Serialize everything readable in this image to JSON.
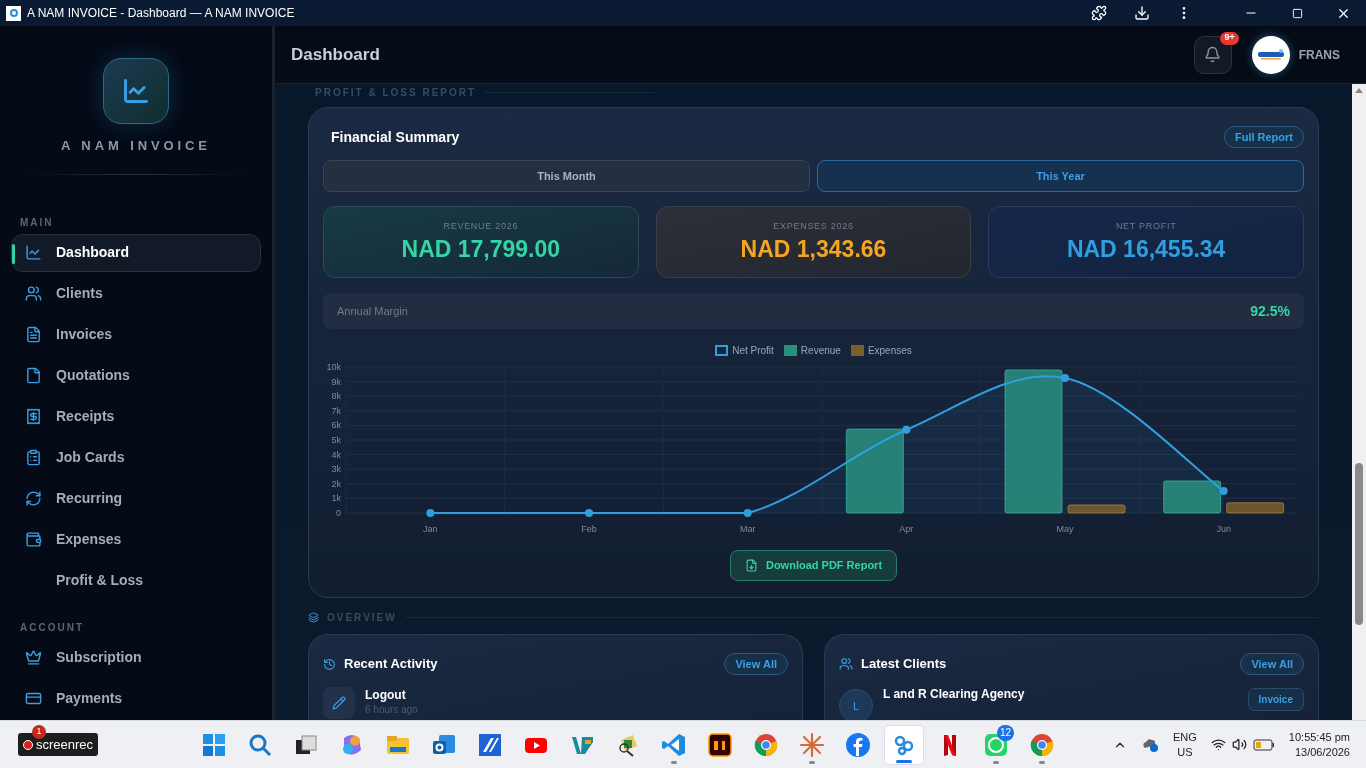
{
  "window": {
    "title": "A NAM INVOICE - Dashboard — A NAM INVOICE"
  },
  "sidebar": {
    "brand": "A NAM INVOICE",
    "sections": [
      {
        "label": "MAIN",
        "items": [
          {
            "label": "Dashboard",
            "selected": true
          },
          {
            "label": "Clients",
            "selected": false
          },
          {
            "label": "Invoices",
            "selected": false
          },
          {
            "label": "Quotations",
            "selected": false
          },
          {
            "label": "Receipts",
            "selected": false
          },
          {
            "label": "Job Cards",
            "selected": false
          },
          {
            "label": "Recurring",
            "selected": false
          },
          {
            "label": "Expenses",
            "selected": false
          },
          {
            "label": "Profit & Loss",
            "selected": false
          }
        ]
      },
      {
        "label": "ACCOUNT",
        "items": [
          {
            "label": "Subscription",
            "selected": false
          },
          {
            "label": "Payments",
            "selected": false
          }
        ]
      }
    ]
  },
  "header": {
    "title": "Dashboard",
    "notification_badge": "9+",
    "user": "FRANS"
  },
  "report": {
    "section_label": "PROFIT & LOSS REPORT",
    "title": "Financial Summary",
    "full_report": "Full Report",
    "tabs": [
      {
        "label": "This Month",
        "selected": false
      },
      {
        "label": "This Year",
        "selected": true
      }
    ],
    "stats": [
      {
        "kind": "revenue",
        "label": "REVENUE 2026",
        "value": "NAD 17,799.00"
      },
      {
        "kind": "expenses",
        "label": "EXPENSES 2026",
        "value": "NAD 1,343.66"
      },
      {
        "kind": "profit",
        "label": "NET PROFIT",
        "value": "NAD 16,455.34"
      }
    ],
    "margin": {
      "label": "Annual Margin",
      "value": "92.5%"
    },
    "chart_data": {
      "type": "bar",
      "stacked": false,
      "grid": true,
      "legend": "top",
      "categories": [
        "Jan",
        "Feb",
        "Mar",
        "Apr",
        "May",
        "Jun"
      ],
      "ylim": [
        0,
        10000
      ],
      "yticks": [
        {
          "value": 0,
          "label": "0"
        },
        {
          "value": 1000,
          "label": "1k"
        },
        {
          "value": 2000,
          "label": "2k"
        },
        {
          "value": 3000,
          "label": "3k"
        },
        {
          "value": 4000,
          "label": "4k"
        },
        {
          "value": 5000,
          "label": "5k"
        },
        {
          "value": 6000,
          "label": "6k"
        },
        {
          "value": 7000,
          "label": "7k"
        },
        {
          "value": 8000,
          "label": "8k"
        },
        {
          "value": 9000,
          "label": "9k"
        },
        {
          "value": 10000,
          "label": "10k"
        }
      ],
      "series": [
        {
          "name": "Net Profit",
          "type": "line",
          "marker": "circle",
          "color": "#2f9fe0",
          "values": [
            0,
            0,
            0,
            5700,
            9250,
            1500
          ]
        },
        {
          "name": "Revenue",
          "type": "bar",
          "color": "#2a8f80",
          "values": [
            0,
            0,
            0,
            5750,
            9800,
            2200
          ]
        },
        {
          "name": "Expenses",
          "type": "bar",
          "color": "#7a5f2c",
          "values": [
            0,
            0,
            0,
            0,
            550,
            700
          ]
        }
      ]
    },
    "download": "Download PDF Report"
  },
  "overview": {
    "section_label": "OVERVIEW",
    "activity": {
      "title": "Recent Activity",
      "view_all": "View All",
      "items": [
        {
          "title": "Logout",
          "time": "6 hours ago"
        }
      ]
    },
    "clients": {
      "title": "Latest Clients",
      "view_all": "View All",
      "items": [
        {
          "initial": "L",
          "name": "L and R Clearing Agency",
          "action": "Invoice"
        }
      ]
    }
  },
  "taskbar": {
    "recorder": {
      "label": "screenrec",
      "badge": "1"
    },
    "apps": [
      {
        "running": false,
        "active": false
      },
      {
        "running": false,
        "active": false
      },
      {
        "running": false,
        "active": false
      },
      {
        "running": false,
        "active": false
      },
      {
        "running": false,
        "active": false
      },
      {
        "running": false,
        "active": false
      },
      {
        "running": false,
        "active": false
      },
      {
        "running": false,
        "active": false
      },
      {
        "running": false,
        "active": false
      },
      {
        "running": false,
        "active": false
      },
      {
        "running": true,
        "active": false
      },
      {
        "running": false,
        "active": false
      },
      {
        "running": false,
        "active": false
      },
      {
        "running": true,
        "active": false
      },
      {
        "running": false,
        "active": false
      },
      {
        "running": true,
        "active": true
      },
      {
        "running": false,
        "active": false
      },
      {
        "running": true,
        "active": false,
        "badge": "12"
      },
      {
        "running": true,
        "active": false
      }
    ],
    "language": "ENG",
    "region": "US",
    "time": "10:55:45 pm",
    "date": "13/06/2026"
  }
}
